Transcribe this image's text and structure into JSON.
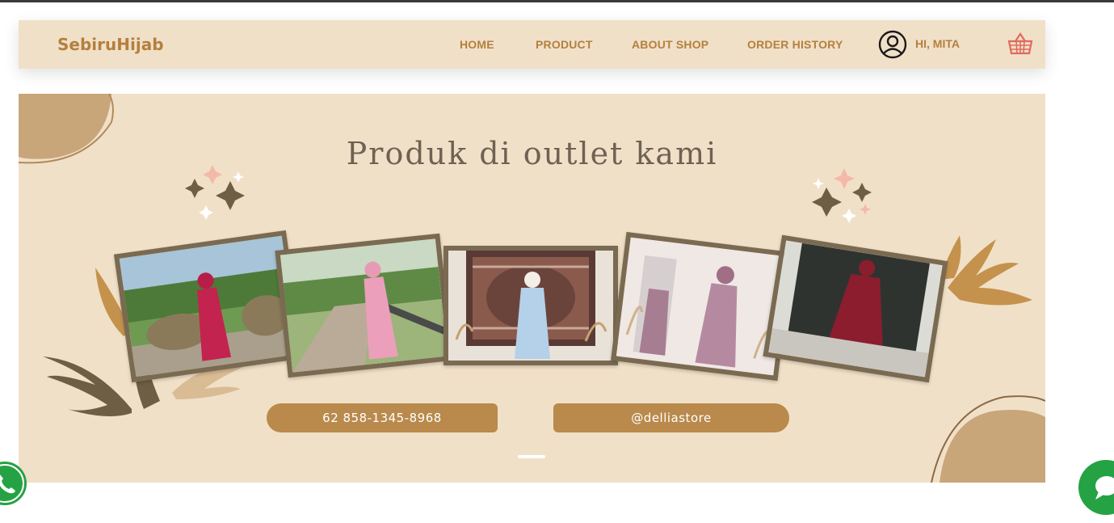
{
  "navbar": {
    "brand": "SebiruHijab",
    "links": [
      "HOME",
      "PRODUCT",
      "ABOUT SHOP",
      "ORDER HISTORY"
    ],
    "user_greeting": "HI, MITA",
    "user_icon": "user-circle-icon",
    "cart_icon": "basket-icon"
  },
  "banner": {
    "headline": "Produk di outlet kami",
    "phone": "62 858-1345-8968",
    "instagram": "@delliastore"
  },
  "floating": {
    "whatsapp_icon": "phone-icon",
    "chat_icon": "chat-icon"
  },
  "colors": {
    "accent": "#b4803e",
    "banner_bg": "#f1e0c8",
    "frame": "#7a6a52",
    "whatsapp": "#25a244"
  }
}
